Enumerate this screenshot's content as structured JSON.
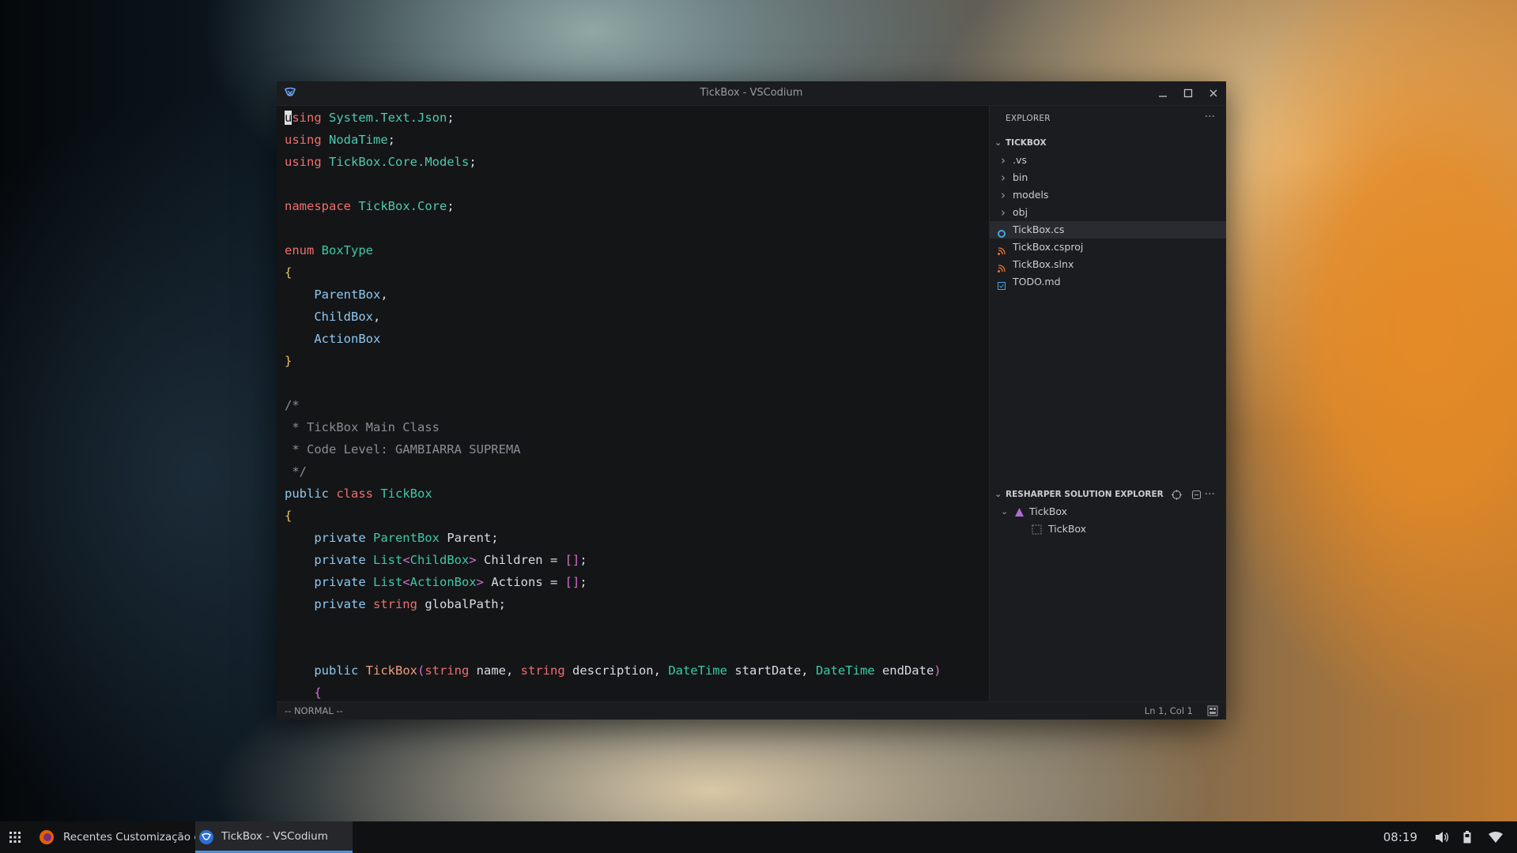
{
  "window": {
    "title": "TickBox - VSCodium"
  },
  "editor": {
    "lines": [
      [
        {
          "t": "u",
          "c": "cursor"
        },
        {
          "t": "sing ",
          "c": "kw"
        },
        {
          "t": "System.Text.Json",
          "c": "ns"
        },
        {
          "t": ";",
          "c": ""
        }
      ],
      [
        {
          "t": "using ",
          "c": "kw"
        },
        {
          "t": "NodaTime",
          "c": "ns"
        },
        {
          "t": ";",
          "c": ""
        }
      ],
      [
        {
          "t": "using ",
          "c": "kw"
        },
        {
          "t": "TickBox.Core.Models",
          "c": "ns"
        },
        {
          "t": ";",
          "c": ""
        }
      ],
      [],
      [
        {
          "t": "namespace ",
          "c": "kw"
        },
        {
          "t": "TickBox.Core",
          "c": "ns"
        },
        {
          "t": ";",
          "c": ""
        }
      ],
      [],
      [
        {
          "t": "enum ",
          "c": "kw"
        },
        {
          "t": "BoxType",
          "c": "ty"
        }
      ],
      [
        {
          "t": "{",
          "c": "br"
        }
      ],
      [
        {
          "t": "    ParentBox",
          "c": "id"
        },
        {
          "t": ",",
          "c": ""
        }
      ],
      [
        {
          "t": "    ChildBox",
          "c": "id"
        },
        {
          "t": ",",
          "c": ""
        }
      ],
      [
        {
          "t": "    ActionBox",
          "c": "id"
        }
      ],
      [
        {
          "t": "}",
          "c": "br"
        }
      ],
      [],
      [
        {
          "t": "/*",
          "c": "cm"
        }
      ],
      [
        {
          "t": " * TickBox Main Class",
          "c": "cm"
        }
      ],
      [
        {
          "t": " * Code Level: GAMBIARRA SUPREMA",
          "c": "cm"
        }
      ],
      [
        {
          "t": " */",
          "c": "cm"
        }
      ],
      [
        {
          "t": "public ",
          "c": "id"
        },
        {
          "t": "class ",
          "c": "kw"
        },
        {
          "t": "TickBox",
          "c": "ty"
        }
      ],
      [
        {
          "t": "{",
          "c": "br"
        }
      ],
      [
        {
          "t": "    private ",
          "c": "id"
        },
        {
          "t": "ParentBox ",
          "c": "ty"
        },
        {
          "t": "Parent;",
          "c": ""
        }
      ],
      [
        {
          "t": "    private ",
          "c": "id"
        },
        {
          "t": "List",
          "c": "ty"
        },
        {
          "t": "<",
          "c": "br2"
        },
        {
          "t": "ChildBox",
          "c": "ty"
        },
        {
          "t": "> ",
          "c": "br2"
        },
        {
          "t": "Children = ",
          "c": ""
        },
        {
          "t": "[]",
          "c": "br2"
        },
        {
          "t": ";",
          "c": ""
        }
      ],
      [
        {
          "t": "    private ",
          "c": "id"
        },
        {
          "t": "List",
          "c": "ty"
        },
        {
          "t": "<",
          "c": "br2"
        },
        {
          "t": "ActionBox",
          "c": "ty"
        },
        {
          "t": "> ",
          "c": "br2"
        },
        {
          "t": "Actions = ",
          "c": ""
        },
        {
          "t": "[]",
          "c": "br2"
        },
        {
          "t": ";",
          "c": ""
        }
      ],
      [
        {
          "t": "    private ",
          "c": "id"
        },
        {
          "t": "string ",
          "c": "kw"
        },
        {
          "t": "globalPath;",
          "c": ""
        }
      ],
      [],
      [],
      [
        {
          "t": "    public ",
          "c": "id"
        },
        {
          "t": "TickBox",
          "c": "fn"
        },
        {
          "t": "(",
          "c": "br2"
        },
        {
          "t": "string ",
          "c": "kw"
        },
        {
          "t": "name, ",
          "c": ""
        },
        {
          "t": "string ",
          "c": "kw"
        },
        {
          "t": "description, ",
          "c": ""
        },
        {
          "t": "DateTime ",
          "c": "ty"
        },
        {
          "t": "startDate, ",
          "c": ""
        },
        {
          "t": "DateTime ",
          "c": "ty"
        },
        {
          "t": "endDate",
          "c": ""
        },
        {
          "t": ")",
          "c": "br2"
        }
      ],
      [
        {
          "t": "    {",
          "c": "br2"
        }
      ]
    ]
  },
  "explorer": {
    "header": "EXPLORER",
    "more": "···",
    "root": "TICKBOX",
    "items": [
      {
        "label": ".vs",
        "kind": "folder"
      },
      {
        "label": "bin",
        "kind": "folder"
      },
      {
        "label": "models",
        "kind": "folder"
      },
      {
        "label": "obj",
        "kind": "folder"
      },
      {
        "label": "TickBox.cs",
        "kind": "csharp",
        "selected": true
      },
      {
        "label": "TickBox.csproj",
        "kind": "rss"
      },
      {
        "label": "TickBox.slnx",
        "kind": "rss"
      },
      {
        "label": "TODO.md",
        "kind": "markdown"
      }
    ]
  },
  "resharper": {
    "header": "RESHARPER SOLUTION EXPLORER",
    "more": "···",
    "solution": "TickBox",
    "project": "TickBox"
  },
  "statusbar": {
    "mode": "-- NORMAL --",
    "position": "Ln 1, Col 1"
  },
  "taskbar": {
    "items": [
      {
        "label": "Recentes Customização e ...",
        "icon": "firefox-icon",
        "active": false
      },
      {
        "label": "TickBox - VSCodium",
        "icon": "vscodium-icon",
        "active": true
      }
    ],
    "clock": "08:19"
  },
  "colors": {
    "keyword": "#ef6f6f",
    "type": "#3ec9a7",
    "identifier": "#8ec9f0",
    "comment": "#8a8d96",
    "taskbar_active_underline": "#4a90e2"
  }
}
